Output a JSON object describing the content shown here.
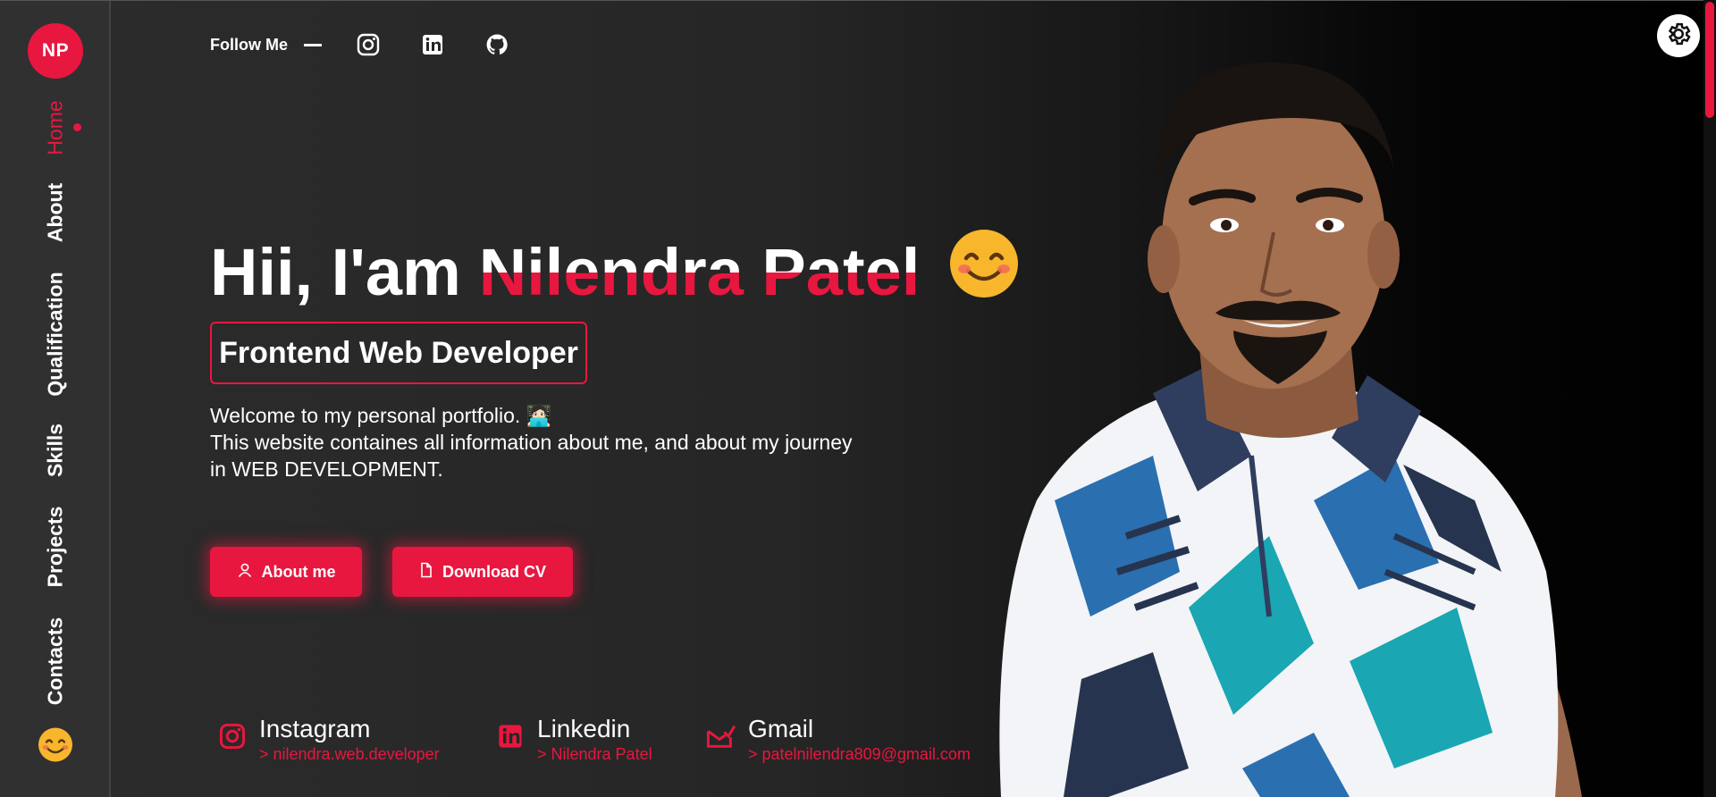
{
  "sidebar": {
    "logo": "NP",
    "nav": [
      "Home",
      "About",
      "Qualification",
      "Skills",
      "Projects",
      "Contacts"
    ],
    "active": "Home",
    "emoji_icon": "smiling-face-icon"
  },
  "hero": {
    "follow_label": "Follow Me",
    "social_icons": [
      "instagram-icon",
      "linkedin-icon",
      "github-icon"
    ],
    "greeting": "Hii, I'am",
    "name": "Nilendra Patel",
    "role": "Frontend Web Developer",
    "intro_line1": "Welcome to my personal portfolio. 🧑🏻‍💻",
    "intro_line2": "This website containes all information about me, and about my journey in WEB DEVELOPMENT.",
    "buttons": {
      "about": "About me",
      "cv": "Download CV"
    }
  },
  "contacts": [
    {
      "label": "Instagram",
      "value": "> nilendra.web.developer",
      "icon": "instagram-icon"
    },
    {
      "label": "Linkedin",
      "value": "> Nilendra Patel",
      "icon": "linkedin-icon"
    },
    {
      "label": "Gmail",
      "value": "> patelnilendra809@gmail.com",
      "icon": "mail-icon"
    }
  ],
  "colors": {
    "accent": "#e8173f",
    "sidebar": "#303030",
    "background": "#262626"
  }
}
